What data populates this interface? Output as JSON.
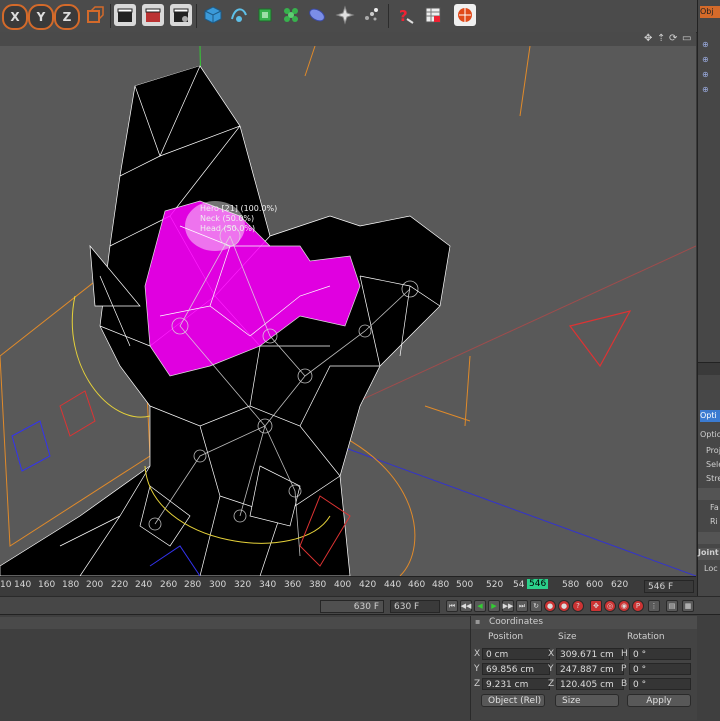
{
  "toolbar": {
    "axis_x": "X",
    "axis_y": "Y",
    "axis_z": "Z",
    "icons": [
      "coordinate-system-icon",
      "render-view-icon",
      "render-picture-viewer-icon",
      "render-settings-icon",
      "cube-icon",
      "spline-pen-icon",
      "subdivision-icon",
      "cloner-icon",
      "deformer-icon",
      "scene-icon",
      "camera-icon",
      "light-icon",
      "help-icon",
      "layout-icon",
      "browser-icon"
    ]
  },
  "viewport": {
    "header_icons": [
      "move-view-icon",
      "zoom-view-icon",
      "rotate-view-icon",
      "maximize-view-icon"
    ],
    "weight_tooltip": [
      "Hero [21] (100.0%)",
      "Neck (50.0%)",
      "Head (50.0%)"
    ]
  },
  "timeline": {
    "ticks": [
      "10",
      "140",
      "160",
      "180",
      "200",
      "220",
      "240",
      "260",
      "280",
      "300",
      "320",
      "340",
      "360",
      "380",
      "400",
      "420",
      "440",
      "460",
      "480",
      "500",
      "520",
      "54",
      "546",
      "580",
      "600",
      "620"
    ],
    "current_frame": "546 F",
    "end_frame": "630 F",
    "end_frame_field": "630 F",
    "marker_label": "546"
  },
  "coordinates": {
    "title": "Coordinates",
    "col_position": "Position",
    "col_size": "Size",
    "col_rotation": "Rotation",
    "rows": [
      {
        "axis": "X",
        "pos": "0 cm",
        "saxis": "X",
        "size": "309.671 cm",
        "raxis": "H",
        "rot": "0 °"
      },
      {
        "axis": "Y",
        "pos": "69.856 cm",
        "saxis": "Y",
        "size": "247.887 cm",
        "raxis": "P",
        "rot": "0 °"
      },
      {
        "axis": "Z",
        "pos": "9.231 cm",
        "saxis": "Z",
        "size": "120.405 cm",
        "raxis": "B",
        "rot": "0 °"
      }
    ],
    "mode_select": "Object (Rel)",
    "size_select": "Size",
    "apply_label": "Apply"
  },
  "right_panel": {
    "tab_top": "Obj",
    "tab_attr_label": "Opti",
    "section_options": "Optio",
    "rows": [
      "Proj",
      "Sele",
      "Stre",
      "Fa",
      "Ri"
    ],
    "section_joint": "Joint",
    "loc_label": "Loc"
  },
  "colors": {
    "accent": "#d46a2a",
    "magenta": "#ff00ff",
    "viewport_bg": "#595959",
    "marker": "#2bd08a"
  }
}
